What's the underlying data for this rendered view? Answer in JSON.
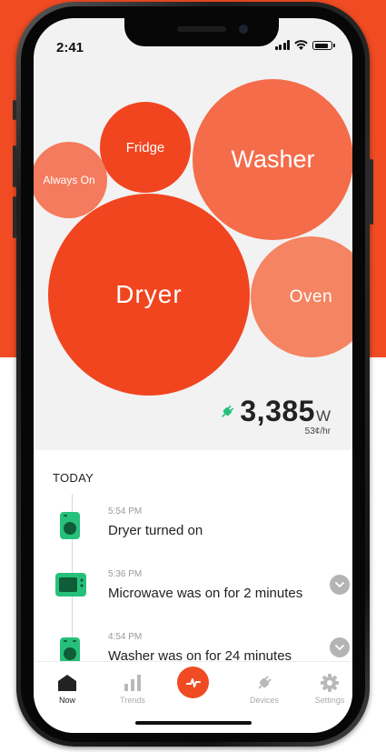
{
  "status_bar": {
    "time": "2:41"
  },
  "bubbles": [
    {
      "label": "Always On",
      "color": "#f47b5d"
    },
    {
      "label": "Fridge",
      "color": "#f1451f"
    },
    {
      "label": "Washer",
      "color": "#f46c4a"
    },
    {
      "label": "Dryer",
      "color": "#f1451f"
    },
    {
      "label": "Oven",
      "color": "#f58462"
    }
  ],
  "power": {
    "value": "3,385",
    "unit": "W",
    "rate": "53¢/hr"
  },
  "feed": {
    "title": "TODAY",
    "events": [
      {
        "time": "5:54 PM",
        "text": "Dryer turned on",
        "icon": "dryer-icon"
      },
      {
        "time": "5:36 PM",
        "text": "Microwave was on for 2 minutes",
        "icon": "microwave-icon"
      },
      {
        "time": "4:54 PM",
        "text": "Washer was on for 24 minutes",
        "icon": "washer-icon"
      }
    ]
  },
  "tabs": [
    {
      "label": "Now",
      "icon": "home-icon"
    },
    {
      "label": "Trends",
      "icon": "bar-chart-icon"
    },
    {
      "label": "Devices",
      "icon": "plug-icon"
    },
    {
      "label": "Settings",
      "icon": "gear-icon"
    }
  ],
  "colors": {
    "accent": "#f04b22",
    "device_green": "#27c07a"
  }
}
